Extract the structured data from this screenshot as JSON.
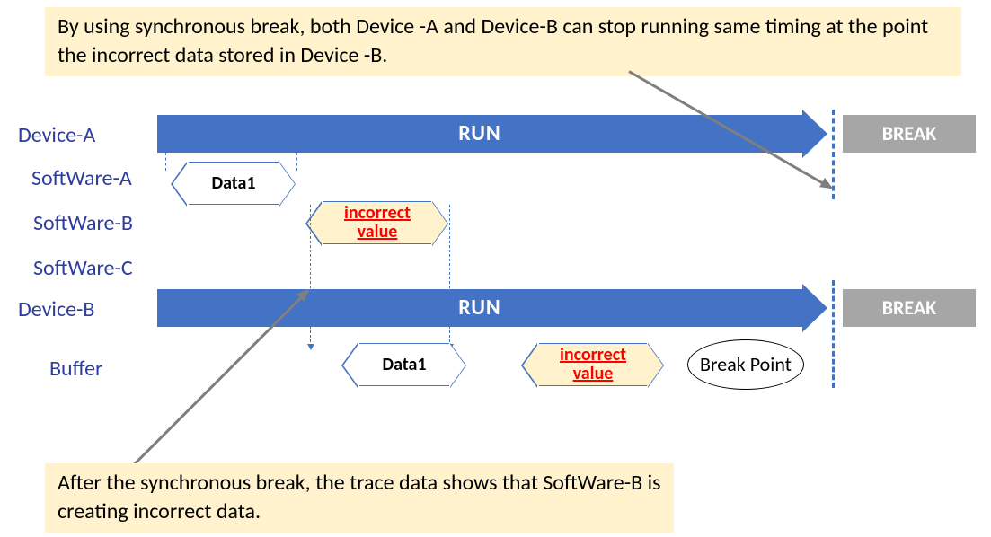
{
  "callouts": {
    "top": "By using synchronous break, both Device -A and Device-B can stop running same timing at the point the incorrect data stored in Device -B.",
    "bottom": "After the synchronous break, the trace data shows that SoftWare-B is creating incorrect data."
  },
  "labels": {
    "deviceA": "Device-A",
    "softwareA": "SoftWare-A",
    "softwareB": "SoftWare-B",
    "softwareC": "SoftWare-C",
    "deviceB": "Device-B",
    "buffer": "Buffer"
  },
  "bars": {
    "run": "RUN",
    "break": "BREAK"
  },
  "hex": {
    "data1": "Data1",
    "incorrect": "incorrect value"
  },
  "ellipse": {
    "breakpoint": "Break Point"
  }
}
